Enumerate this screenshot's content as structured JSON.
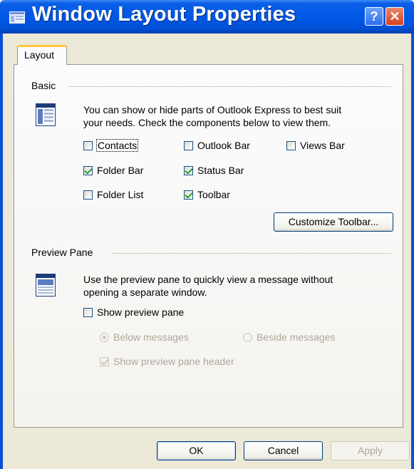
{
  "window": {
    "title": "Window Layout Properties",
    "help_label": "?",
    "close_label": "✕"
  },
  "tabs": [
    {
      "label": "Layout"
    }
  ],
  "basic": {
    "heading": "Basic",
    "description_line1": "You can show or hide parts of Outlook Express to best suit",
    "description_line2": "your needs.  Check the components below to view them.",
    "checkboxes": [
      {
        "label": "Contacts",
        "checked": false
      },
      {
        "label": "Outlook Bar",
        "checked": false
      },
      {
        "label": "Views Bar",
        "checked": false
      },
      {
        "label": "Folder Bar",
        "checked": true
      },
      {
        "label": "Status Bar",
        "checked": true
      },
      {
        "label": "Folder List",
        "checked": false
      },
      {
        "label": "Toolbar",
        "checked": true
      }
    ],
    "customize_label": "Customize Toolbar..."
  },
  "preview": {
    "heading": "Preview Pane",
    "description_line1": "Use the preview pane to quickly view a message without",
    "description_line2": "opening a separate window.",
    "show_preview": {
      "label": "Show preview pane",
      "checked": false
    },
    "below": {
      "label": "Below messages",
      "selected": true
    },
    "beside": {
      "label": "Beside messages",
      "selected": false
    },
    "show_header": {
      "label": "Show preview pane header",
      "checked": true
    }
  },
  "buttons": {
    "ok": "OK",
    "cancel": "Cancel",
    "apply": "Apply"
  },
  "colors": {
    "titlebar": "#0058e6",
    "face": "#ece9d8",
    "tab_highlight": "#ffc73c"
  }
}
